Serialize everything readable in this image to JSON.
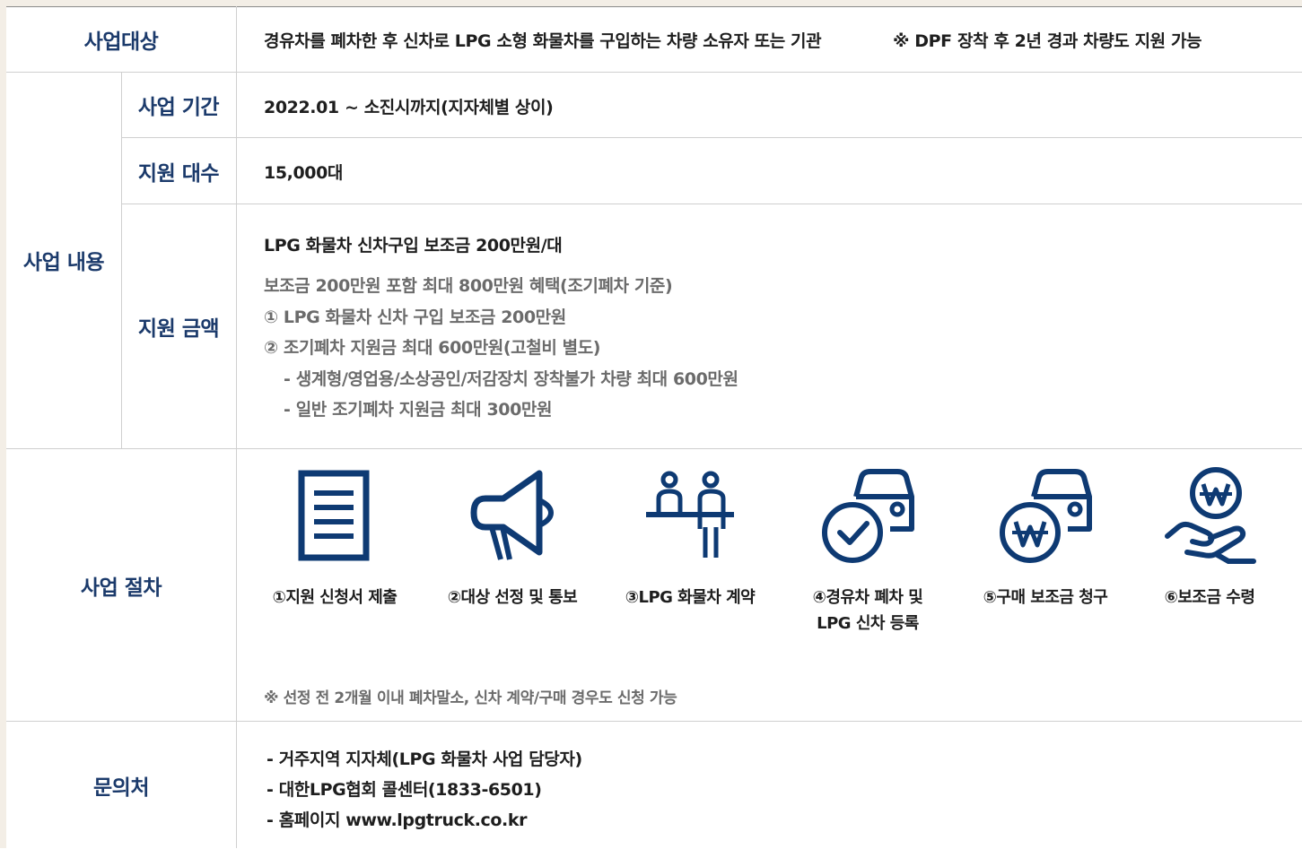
{
  "rows": {
    "target": {
      "header": "사업대상",
      "text": "경유차를 폐차한 후 신차로 LPG 소형 화물차를 구입하는 차량 소유자 또는 기관",
      "note": "※ DPF 장착 후 2년 경과 차량도 지원 가능"
    },
    "content": {
      "header": "사업 내용",
      "period": {
        "header": "사업 기간",
        "text": "2022.01 ~ 소진시까지(지자체별 상이)"
      },
      "count": {
        "header": "지원 대수",
        "text": "15,000대"
      },
      "amount": {
        "header": "지원 금액",
        "title": "LPG 화물차 신차구입 보조금 200만원/대",
        "lines": [
          "보조금 200만원 포함 최대 800만원 혜택(조기폐차 기준)",
          "① LPG 화물차 신차 구입 보조금 200만원",
          "② 조기폐차 지원금 최대 600만원(고철비 별도)",
          "- 생계형/영업용/소상공인/저감장치 장착불가 차량 최대 600만원",
          "- 일반 조기폐차 지원금 최대 300만원"
        ]
      }
    },
    "procedure": {
      "header": "사업 절차",
      "steps": [
        {
          "icon": "document-icon",
          "label": "①지원 신청서 제출"
        },
        {
          "icon": "megaphone-icon",
          "label": "②대상 선정 및 통보"
        },
        {
          "icon": "people-contract-icon",
          "label": "③LPG 화물차 계약"
        },
        {
          "icon": "car-check-icon",
          "label": "④경유차 폐차 및",
          "label2": "LPG 신차 등록"
        },
        {
          "icon": "car-won-icon",
          "label": "⑤구매 보조금 청구"
        },
        {
          "icon": "hand-won-icon",
          "label": "⑥보조금 수령"
        }
      ],
      "note": "※ 선정 전 2개월 이내 폐차말소, 신차 계약/구매 경우도 신청 가능"
    },
    "inquiry": {
      "header": "문의처",
      "lines": [
        "- 거주지역 지자체(LPG 화물차 사업 담당자)",
        "- 대한LPG협회 콜센터(1833-6501)",
        "- 홈페이지 www.lpgtruck.co.kr"
      ]
    }
  },
  "colors": {
    "navy": "#1b3a6b",
    "icon": "#0e3a73",
    "gray_text": "#6b6b6b"
  }
}
